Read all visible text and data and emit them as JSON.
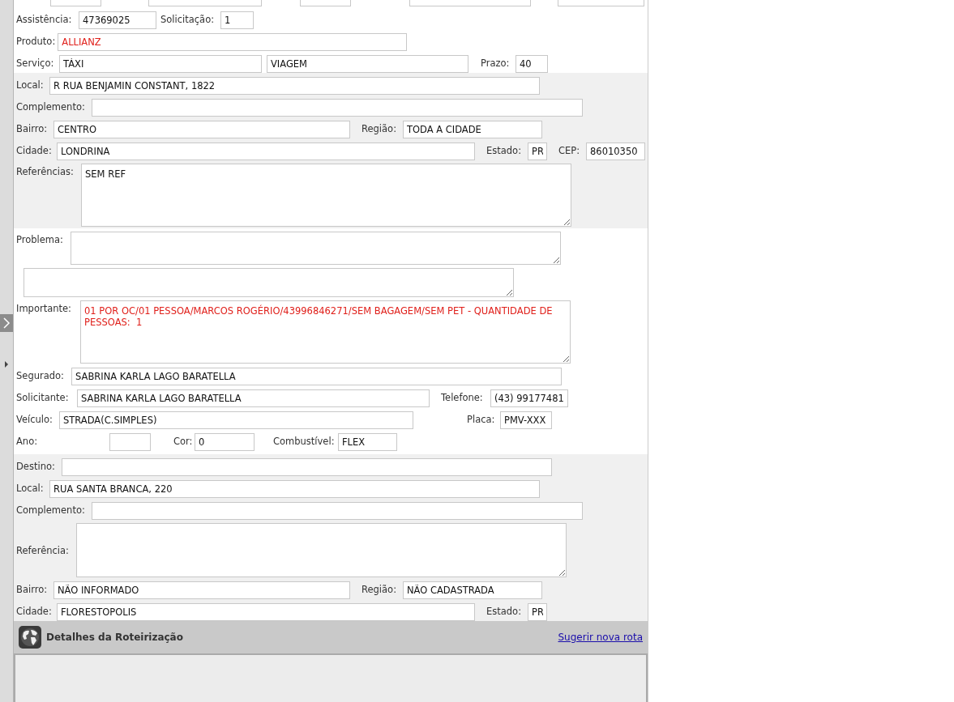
{
  "sections": [
    {
      "rows": [
        {
          "items": [
            {
              "kind": "label",
              "text": "Assistência:"
            },
            {
              "kind": "field",
              "value": "47369025",
              "alert": false
            },
            {
              "kind": "label",
              "text": "Solicitação:"
            },
            {
              "kind": "field",
              "value": "1",
              "alert": false
            }
          ]
        },
        {
          "items": [
            {
              "kind": "label",
              "text": "Produto:"
            },
            {
              "kind": "field",
              "value": "ALLIANZ",
              "alert": true
            }
          ]
        },
        {
          "items": [
            {
              "kind": "label",
              "text": "Serviço:"
            },
            {
              "kind": "field",
              "value": "TÁXI",
              "alert": false
            },
            {
              "kind": "field",
              "value": "VIAGEM",
              "alert": false
            },
            {
              "kind": "label",
              "text": "Prazo:"
            },
            {
              "kind": "field",
              "value": "40",
              "alert": false
            }
          ]
        }
      ]
    },
    {
      "shaded": true,
      "rows": [
        {
          "items": [
            {
              "kind": "label",
              "text": "Local:"
            },
            {
              "kind": "field",
              "value": "R RUA BENJAMIN CONSTANT, 1822",
              "alert": false
            }
          ]
        },
        {
          "items": [
            {
              "kind": "label",
              "text": "Complemento:"
            },
            {
              "kind": "field"
            }
          ]
        },
        {
          "items": [
            {
              "kind": "label",
              "text": "Bairro:"
            },
            {
              "kind": "field",
              "value": "CENTRO",
              "alert": false
            },
            {
              "kind": "label",
              "text": "Região:"
            },
            {
              "kind": "field",
              "value": "TODA A CIDADE",
              "alert": false
            }
          ]
        },
        {
          "items": [
            {
              "kind": "label",
              "text": "Cidade:"
            },
            {
              "kind": "field",
              "value": "LONDRINA",
              "alert": false
            },
            {
              "kind": "label",
              "text": "Estado:"
            },
            {
              "kind": "field",
              "value": "PR",
              "alert": false
            },
            {
              "kind": "label",
              "text": "CEP:"
            },
            {
              "kind": "field",
              "value": "86010350",
              "alert": false
            }
          ]
        },
        {
          "items": [
            {
              "kind": "label",
              "text": "Referências:"
            },
            {
              "kind": "textarea",
              "value": "SEM REF",
              "alert": false
            }
          ]
        }
      ]
    },
    {
      "rows": [
        {
          "items": [
            {
              "kind": "label",
              "text": "Problema:"
            },
            {
              "kind": "textarea"
            }
          ]
        },
        {
          "items": [
            {
              "kind": "textarea"
            }
          ]
        },
        {
          "items": [
            {
              "kind": "label",
              "text": "Importante:"
            },
            {
              "kind": "textarea",
              "value": "01 POR OC/01 PESSOA/MARCOS ROGÉRIO/43996846271/SEM BAGAGEM/SEM PET - QUANTIDADE DE PESSOAS:  1",
              "alert": true
            }
          ]
        },
        {
          "items": [
            {
              "kind": "label",
              "text": "Segurado:"
            },
            {
              "kind": "field",
              "value": "SABRINA KARLA LAGO BARATELLA",
              "alert": false
            }
          ]
        },
        {
          "items": [
            {
              "kind": "label",
              "text": "Solicitante:"
            },
            {
              "kind": "field",
              "value": "SABRINA KARLA LAGO BARATELLA",
              "alert": false
            },
            {
              "kind": "label",
              "text": "Telefone:"
            },
            {
              "kind": "field",
              "value": "(43) 99177481",
              "alert": false
            }
          ]
        },
        {
          "items": [
            {
              "kind": "label",
              "text": "Veículo:"
            },
            {
              "kind": "field",
              "value": "STRADA(C.SIMPLES)",
              "alert": false
            },
            {
              "kind": "label",
              "text": "Placa:"
            },
            {
              "kind": "field",
              "value": "PMV-XXX",
              "alert": false
            }
          ]
        },
        {
          "items": [
            {
              "kind": "label",
              "text": "Ano:"
            },
            {
              "kind": "field"
            },
            {
              "kind": "label",
              "text": "Cor:"
            },
            {
              "kind": "field",
              "value": "0",
              "alert": false
            },
            {
              "kind": "label",
              "text": "Combustível:"
            },
            {
              "kind": "field",
              "value": "FLEX",
              "alert": false
            }
          ]
        }
      ]
    },
    {
      "shaded": true,
      "rows": [
        {
          "items": [
            {
              "kind": "label",
              "text": "Destino:"
            },
            {
              "kind": "field"
            }
          ]
        },
        {
          "items": [
            {
              "kind": "label",
              "text": "Local:"
            },
            {
              "kind": "field",
              "value": "RUA SANTA BRANCA, 220",
              "alert": false
            }
          ]
        },
        {
          "items": [
            {
              "kind": "label",
              "text": "Complemento:"
            },
            {
              "kind": "field"
            }
          ]
        },
        {
          "items": [
            {
              "kind": "label",
              "text": "Referência:"
            },
            {
              "kind": "textarea"
            }
          ]
        },
        {
          "items": [
            {
              "kind": "label",
              "text": "Bairro:"
            },
            {
              "kind": "field",
              "value": "NÃO INFORMADO",
              "alert": false
            },
            {
              "kind": "label",
              "text": "Região:"
            },
            {
              "kind": "field",
              "value": "NÃO CADASTRADA",
              "alert": false
            }
          ]
        },
        {
          "items": [
            {
              "kind": "label",
              "text": "Cidade:"
            },
            {
              "kind": "field",
              "value": "FLORESTOPOLIS",
              "alert": false
            },
            {
              "kind": "label",
              "text": "Estado:"
            },
            {
              "kind": "field",
              "value": "PR",
              "alert": false
            }
          ]
        }
      ]
    }
  ],
  "routing": {
    "title": "Detalhes da Roteirização",
    "link": "Sugerir nova rota"
  }
}
